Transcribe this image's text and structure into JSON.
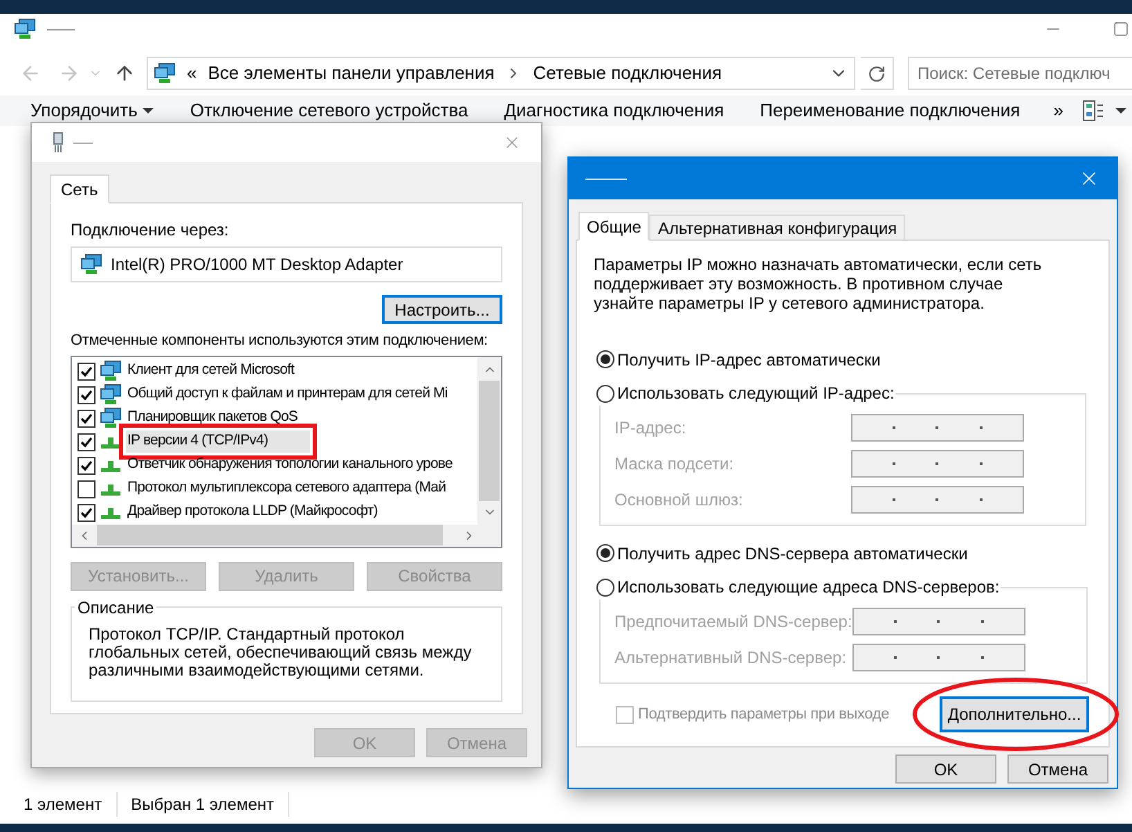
{
  "explorer": {
    "address": {
      "prefix": "«",
      "crumbs": [
        "Все элементы панели управления",
        "Сетевые подключения"
      ]
    },
    "search": {
      "placeholder": "Поиск: Сетевые подключ"
    },
    "toolbar": [
      {
        "label": "Упорядочить",
        "dropdown": true
      },
      {
        "label": "Отключение сетевого устройства",
        "dropdown": false
      },
      {
        "label": "Диагностика подключения",
        "dropdown": false
      },
      {
        "label": "Переименование подключения",
        "dropdown": false
      }
    ],
    "overflow": "»",
    "status_bar": [
      "1 элемент",
      "Выбран 1 элемент"
    ]
  },
  "network_dialog": {
    "tabs": [
      {
        "label": "Сеть",
        "selected": true
      }
    ],
    "connect_label": "Подключение через:",
    "adapter": "Intel(R) PRO/1000 MT Desktop Adapter",
    "configure_button": "Настроить...",
    "components_label": "Отмеченные компоненты используются этим подключением:",
    "components": [
      {
        "label": "Клиент для сетей Microsoft",
        "checked": true,
        "selected": false,
        "boxed": false
      },
      {
        "label": "Общий доступ к файлам и принтерам для сетей Mi",
        "checked": true,
        "selected": false,
        "boxed": false
      },
      {
        "label": "Планировщик пакетов QoS",
        "checked": true,
        "selected": false,
        "boxed": false
      },
      {
        "label": "IP версии 4 (TCP/IPv4)",
        "checked": true,
        "selected": true,
        "boxed": true
      },
      {
        "label": "Ответчик обнаружения топологии канального урове",
        "checked": true,
        "selected": false,
        "boxed": false
      },
      {
        "label": "Протокол мультиплексора сетевого адаптера (Май",
        "checked": false,
        "selected": false,
        "boxed": false
      },
      {
        "label": "Драйвер протокола LLDP (Майкрософт)",
        "checked": true,
        "selected": false,
        "boxed": false
      }
    ],
    "buttons": [
      {
        "label": "Установить...",
        "disabled": true
      },
      {
        "label": "Удалить",
        "disabled": true
      },
      {
        "label": "Свойства",
        "disabled": true
      }
    ],
    "description": {
      "legend": "Описание",
      "text": "Протокол TCP/IP. Стандартный протокол глобальных сетей, обеспечивающий связь между различными взаимодействующими сетями."
    },
    "footer_buttons": [
      {
        "label": "OK",
        "disabled": true
      },
      {
        "label": "Отмена",
        "disabled": true
      }
    ]
  },
  "ip_dialog": {
    "tabs": [
      {
        "label": "Общие",
        "selected": true
      },
      {
        "label": "Альтернативная конфигурация",
        "selected": false
      }
    ],
    "intro": "Параметры IP можно назначать автоматически, если сеть поддерживает эту возможность. В противном случае узнайте параметры IP у сетевого администратора.",
    "ip_options": [
      {
        "label": "Получить IP-адрес автоматически",
        "selected": true
      },
      {
        "label": "Использовать следующий IP-адрес:",
        "selected": false,
        "fields": [
          {
            "label": "IP-адрес:",
            "disabled": true
          },
          {
            "label": "Маска подсети:",
            "disabled": true
          },
          {
            "label": "Основной шлюз:",
            "disabled": true
          }
        ]
      }
    ],
    "dns_options": [
      {
        "label": "Получить адрес DNS-сервера автоматически",
        "selected": true
      },
      {
        "label": "Использовать следующие адреса DNS-серверов:",
        "selected": false,
        "fields": [
          {
            "label": "Предпочитаемый DNS-сервер:",
            "disabled": true
          },
          {
            "label": "Альтернативный DNS-сервер:",
            "disabled": true
          }
        ]
      }
    ],
    "confirm": {
      "label": "Подтвердить параметры при выходе",
      "checked": false,
      "disabled": true
    },
    "advanced_button": {
      "label": "Дополнительно...",
      "circled": true
    },
    "footer_buttons": [
      {
        "label": "OK",
        "disabled": false
      },
      {
        "label": "Отмена",
        "disabled": false
      }
    ]
  }
}
